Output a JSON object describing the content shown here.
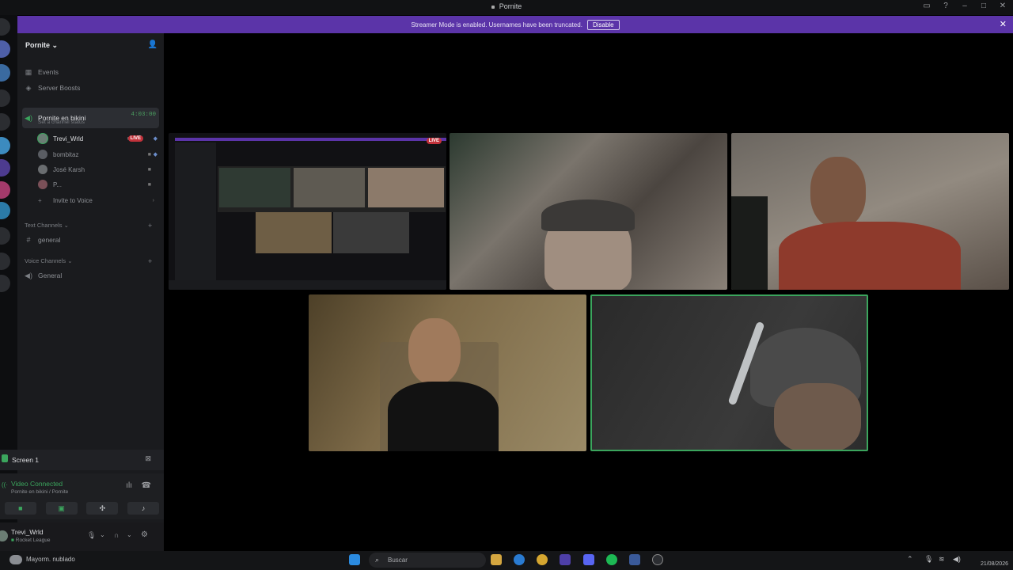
{
  "window": {
    "title": "Pornite"
  },
  "banner": {
    "message": "Streamer Mode is enabled. Usernames have been truncated.",
    "button": "Disable"
  },
  "server": {
    "name": "Pornite"
  },
  "nav": {
    "events": "Events",
    "boosts": "Server Boosts"
  },
  "voice_channel": {
    "name": "Pornite en bikini",
    "status": "Set a channel status",
    "timer": "4:03:00",
    "members": [
      {
        "name": "Trevi_Wrld",
        "live": "LIVE"
      },
      {
        "name": "bombitaz"
      },
      {
        "name": "José Karsh"
      },
      {
        "name": "P..."
      }
    ],
    "invite": "Invite to Voice"
  },
  "categories": {
    "text": "Text Channels",
    "text_channel": "general",
    "voice": "Voice Channels",
    "voice_channel": "General"
  },
  "screen_panel": {
    "label": "Screen 1"
  },
  "connection": {
    "status": "Video Connected",
    "location": "Pornite en bikini / Pornite"
  },
  "user": {
    "name": "Trevi_Wrld",
    "activity": "Rocket League"
  },
  "taskbar": {
    "weather": "Mayorm. nublado",
    "search_placeholder": "Buscar",
    "date": "21/08/2026"
  },
  "colors": {
    "banner": "#5b34a8",
    "connected": "#3ba55d",
    "live": "#c2323b",
    "speaking": "#3ba55d"
  }
}
